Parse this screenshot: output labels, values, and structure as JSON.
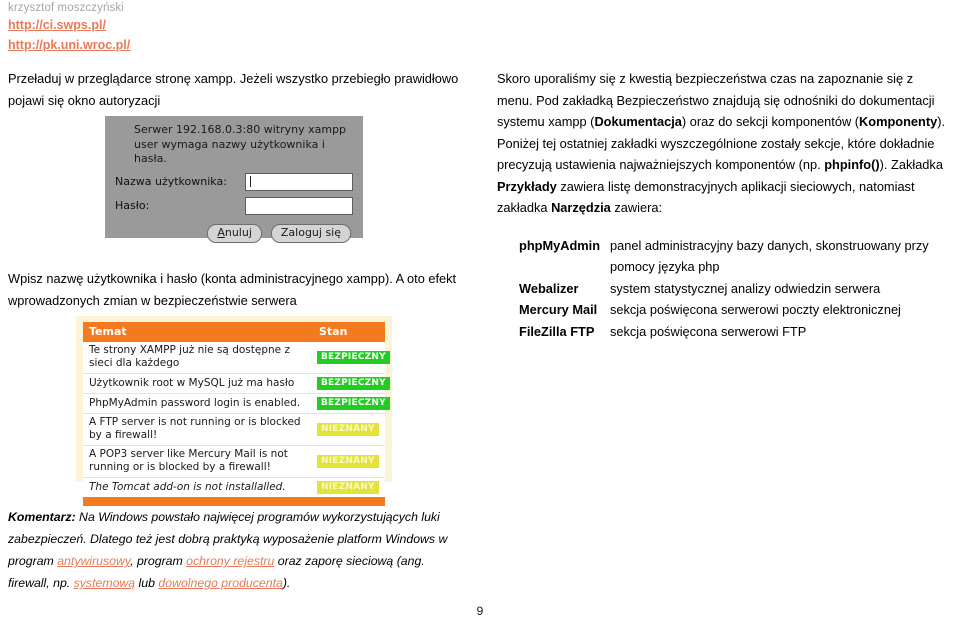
{
  "header": {
    "author": "krzysztof moszczyński",
    "links": [
      "http://ci.swps.pl/",
      "http://pk.uni.wroc.pl/"
    ],
    "link_color": "#e8795b"
  },
  "left_column": {
    "intro_paragraph": "Przeładuj w przeglądarce stronę xampp. Jeżeli wszystko przebiegło prawidłowo pojawi się okno autoryzacji",
    "after_dialog_paragraph": "Wpisz nazwę użytkownika i hasło (konta administracyjnego xampp). A oto efekt wprowadzonych zmian w bezpieczeństwie serwera"
  },
  "auth_dialog": {
    "message_line1": "Serwer 192.168.0.3:80 witryny xampp",
    "message_line2": "user wymaga nazwy użytkownika i hasła.",
    "username_label": "Nazwa użytkownika:",
    "username_value": "",
    "password_label": "Hasło:",
    "password_value": "",
    "cancel_button": "Anuluj",
    "cancel_button_mnemonic": "A",
    "cancel_button_rest": "nuluj",
    "login_button": "Zaloguj się",
    "background_color": "#9a9a9a"
  },
  "security_table": {
    "columns": [
      "Temat",
      "Stan"
    ],
    "header_color": "#f47a20",
    "frame_color": "#fdf4d8",
    "status_colors": {
      "secure": "#22cc22",
      "unknown": "#e3e33a"
    },
    "rows": [
      {
        "topic": "Te strony XAMPP już nie są dostępne z sieci dla każdego",
        "status": "BEZPIECZNY",
        "status_kind": "secure",
        "italic": false
      },
      {
        "topic": "Użytkownik root w MySQL już ma hasło",
        "status": "BEZPIECZNY",
        "status_kind": "secure",
        "italic": false
      },
      {
        "topic": "PhpMyAdmin password login is enabled.",
        "status": "BEZPIECZNY",
        "status_kind": "secure",
        "italic": false
      },
      {
        "topic": "A FTP server is not running or is blocked by a firewall!",
        "status": "NIEZNANY",
        "status_kind": "unknown",
        "italic": false
      },
      {
        "topic": "A POP3 server like Mercury Mail is not running or is blocked by a firewall!",
        "status": "NIEZNANY",
        "status_kind": "unknown",
        "italic": false
      },
      {
        "topic": "The Tomcat add-on is not installalled.",
        "status": "NIEZNANY",
        "status_kind": "unknown",
        "italic": true
      }
    ]
  },
  "right_column": {
    "paragraph_parts": [
      {
        "text": "Skoro uporaliśmy się z kwestią bezpieczeństwa czas na zapoznanie się z menu. Pod zakładką Bezpieczeństwo znajdują się odnośniki do dokumentacji systemu xampp (",
        "bold": false
      },
      {
        "text": "Dokumentacja",
        "bold": true
      },
      {
        "text": ") oraz do sekcji komponentów (",
        "bold": false
      },
      {
        "text": "Komponenty",
        "bold": true
      },
      {
        "text": "). Poniżej tej ostatniej zakładki wyszczególnione zostały sekcje, które dokładnie precyzują ustawienia najważniejszych komponentów (np. ",
        "bold": false
      },
      {
        "text": "phpinfo()",
        "bold": true
      },
      {
        "text": "). Zakładka ",
        "bold": false
      },
      {
        "text": "Przykłady",
        "bold": true
      },
      {
        "text": " zawiera listę demonstracyjnych aplikacji sieciowych, natomiast zakładka ",
        "bold": false
      },
      {
        "text": "Narzędzia",
        "bold": true
      },
      {
        "text": " zawiera:",
        "bold": false
      }
    ],
    "tools": [
      {
        "term": "phpMyAdmin",
        "desc": "panel administracyjny bazy danych, skonstruowany przy pomocy języka php"
      },
      {
        "term": "Webalizer",
        "desc": "system statystycznej analizy odwiedzin serwera"
      },
      {
        "term": "Mercury Mail",
        "desc": "sekcja poświęcona serwerowi poczty elektronicznej"
      },
      {
        "term": "FileZilla FTP",
        "desc": "sekcja poświęcona serwerowi FTP"
      }
    ]
  },
  "comment": {
    "label": "Komentarz:",
    "parts": [
      {
        "text": " Na Windows powstało najwięcej programów wykorzystujących luki zabezpieczeń. Dlatego też jest dobrą praktyką wyposażenie platform Windows w program ",
        "link": false
      },
      {
        "text": "antywirusowy",
        "link": true
      },
      {
        "text": ", program ",
        "link": false
      },
      {
        "text": "ochrony rejestru",
        "link": true
      },
      {
        "text": " oraz zaporę sieciową (ang. firewall, np. ",
        "link": false
      },
      {
        "text": "systemową",
        "link": true
      },
      {
        "text": " lub ",
        "link": false
      },
      {
        "text": "dowolnego producenta",
        "link": true
      },
      {
        "text": ").",
        "link": false
      }
    ]
  },
  "footer": {
    "page_number": "9"
  }
}
